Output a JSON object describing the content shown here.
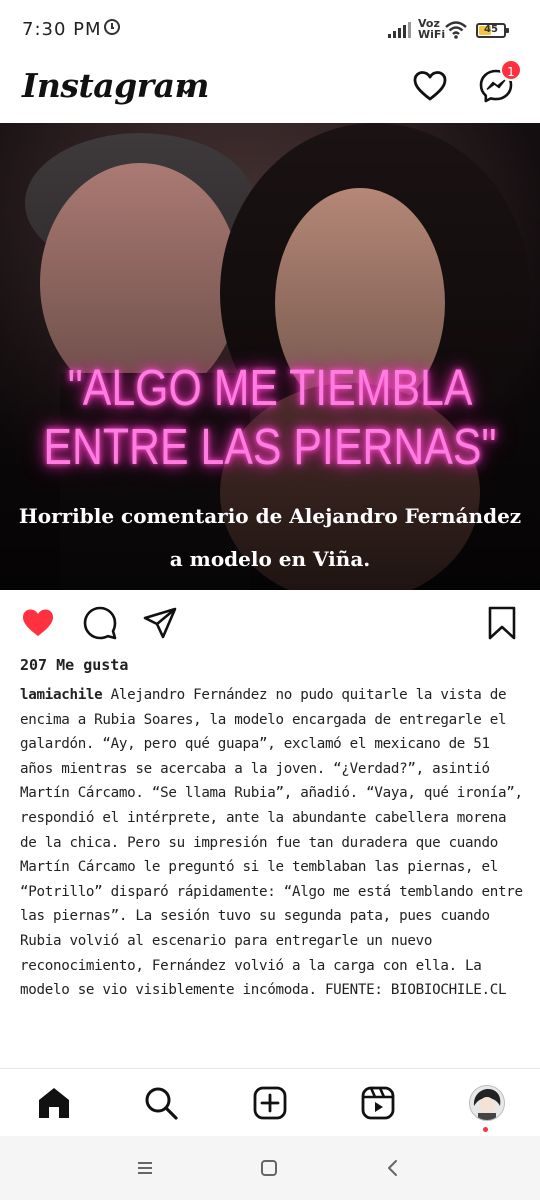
{
  "status_bar": {
    "time": "7:30 PM",
    "network_label_1": "Voz",
    "network_label_2": "WiFi",
    "battery": "45",
    "battery_level": 0.45
  },
  "header": {
    "app_name": "Instagram",
    "messages_badge": "1"
  },
  "post": {
    "image": {
      "headline_line1": "\"ALGO ME TIEMBLA",
      "headline_line2": "ENTRE LAS PIERNAS\"",
      "subtitle_line1": "Horrible comentario de Alejandro Fernández",
      "subtitle_line2": "a modelo en Viña."
    },
    "liked": true,
    "likes_text": "207 Me gusta",
    "username": "lamiachile",
    "caption": "Alejandro Fernández no pudo quitarle la vista de encima a Rubia Soares, la modelo encargada de entregarle el galardón. “Ay, pero qué guapa”, exclamó el mexicano de 51 años mientras se acercaba a la joven. “¿Verdad?”, asintió Martín Cárcamo. “Se llama Rubia”, añadió. “Vaya, qué ironía”, respondió el intérprete, ante la abundante cabellera morena de la chica. Pero su impresión fue tan duradera que cuando Martín Cárcamo le preguntó si le temblaban las piernas, el “Potrillo” disparó rápidamente: “Algo me está temblando entre las piernas”. La sesión tuvo su segunda pata, pues cuando Rubia volvió al escenario para entregarle un nuevo reconocimiento, Fernández volvió a la carga con ella. La modelo se vio visiblemente incómoda. FUENTE: BIOBIOCHILE.CL"
  },
  "colors": {
    "like_red": "#ff3040",
    "headline_pink": "#ff7ce0"
  },
  "icons": [
    "alarm-icon",
    "signal-icon",
    "wifi-icon",
    "battery-icon",
    "heart-icon",
    "messenger-icon",
    "comment-icon",
    "share-icon",
    "bookmark-icon",
    "home-icon",
    "search-icon",
    "create-icon",
    "reels-icon",
    "menu-icon",
    "square-icon",
    "back-icon"
  ]
}
